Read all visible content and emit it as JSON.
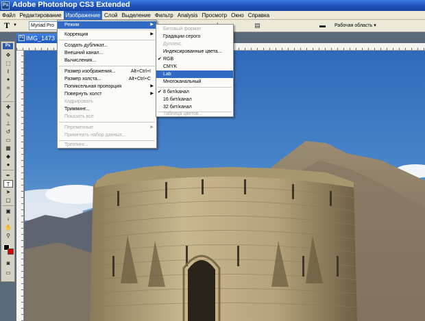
{
  "window": {
    "title": "Adobe Photoshop CS3 Extended",
    "app_icon": "Ps"
  },
  "menubar": {
    "items": [
      "Файл",
      "Редактирование",
      "Изображение",
      "Слой",
      "Выделение",
      "Фильтр",
      "Analysis",
      "Просмотр",
      "Окно",
      "Справка"
    ],
    "active_index": 2
  },
  "options_bar": {
    "tool_glyph": "T",
    "font_family": "Myriad Pro",
    "workspace_label": "Рабочая область ▾"
  },
  "toolbox": {
    "badge": "Ps"
  },
  "document": {
    "tab_title": "IMG_1473",
    "icon": "Ps"
  },
  "image_menu": {
    "items": [
      {
        "label": "Режим",
        "submenu": true,
        "highlight": true
      },
      {
        "label": "Коррекция",
        "submenu": true
      },
      {
        "label": "Создать дубликат..."
      },
      {
        "label": "Внешний канал..."
      },
      {
        "label": "Вычисления..."
      },
      {
        "label": "Размер изображения...",
        "shortcut": "Alt+Ctrl+I"
      },
      {
        "label": "Размер холста...",
        "shortcut": "Alt+Ctrl+C"
      },
      {
        "label": "Попиксельная пропорция",
        "submenu": true
      },
      {
        "label": "Повернуть холст",
        "submenu": true
      },
      {
        "label": "Кадрировать",
        "disabled": true
      },
      {
        "label": "Тримминг..."
      },
      {
        "label": "Показать все",
        "disabled": true
      },
      {
        "label": "Переменные",
        "submenu": true,
        "disabled": true
      },
      {
        "label": "Применить набор данных...",
        "disabled": true
      },
      {
        "label": "Треппинг...",
        "disabled": true
      }
    ]
  },
  "mode_submenu": {
    "items": [
      {
        "label": "Битовый формат",
        "disabled": true
      },
      {
        "label": "Градации серого"
      },
      {
        "label": "Дуплекс",
        "disabled": true
      },
      {
        "label": "Индексированные цвета..."
      },
      {
        "label": "RGB",
        "checked": true
      },
      {
        "label": "CMYK"
      },
      {
        "label": "Lab",
        "highlight": true
      },
      {
        "label": "Многоканальный"
      },
      {
        "label": "8 бит/канал",
        "checked": true
      },
      {
        "label": "16 бит/канал"
      },
      {
        "label": "32 бит/канал"
      },
      {
        "label": "Таблица цветов...",
        "disabled": true
      }
    ]
  },
  "colors": {
    "titlebar": "#1c4fb8",
    "menu_highlight": "#316ac5",
    "foreground_swatch": "#000000",
    "background_swatch": "#d40000"
  }
}
